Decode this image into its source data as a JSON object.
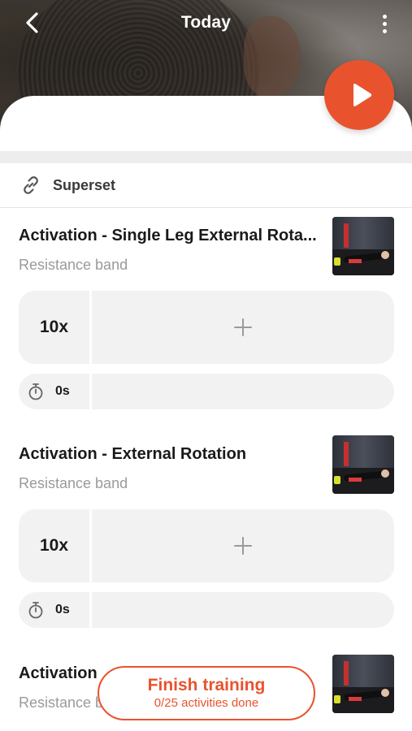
{
  "header": {
    "title": "Today"
  },
  "superset": {
    "label": "Superset"
  },
  "exercises": [
    {
      "title": "Activation - Single Leg External Rota...",
      "equipment": "Resistance band",
      "reps": "10x",
      "rest": "0s"
    },
    {
      "title": "Activation - External Rotation",
      "equipment": "Resistance band",
      "reps": "10x",
      "rest": "0s"
    },
    {
      "title": "Activation",
      "equipment": "Resistance b"
    }
  ],
  "finish": {
    "label": "Finish training",
    "progress": "0/25 activities done"
  },
  "colors": {
    "accent": "#e8532e",
    "card_bg": "#f2f2f2",
    "muted_text": "#9a9a9a"
  },
  "icons": {
    "back": "chevron-left-icon",
    "more": "more-vertical-icon",
    "play": "play-icon",
    "superset": "link-icon",
    "add": "plus-icon",
    "rest": "stopwatch-icon"
  }
}
